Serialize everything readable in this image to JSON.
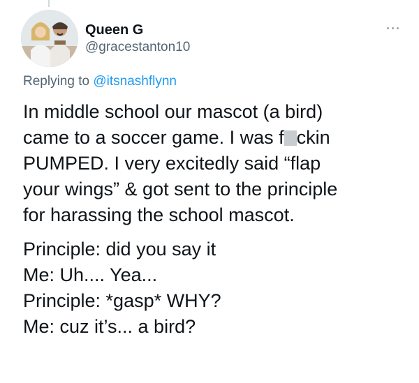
{
  "tweet": {
    "display_name": "Queen G",
    "handle": "@gracestanton10",
    "replying_prefix": "Replying to",
    "replying_to": "@itsnashflynn",
    "paragraph1": {
      "l1": "In middle school our mascot (a bird)",
      "l2_before": "came to a soccer game. I was f",
      "l2_after": "ckin",
      "l3": "PUMPED. I very excitedly said “flap",
      "l4": "your wings” & got sent to the principle",
      "l5": "for harassing the school mascot."
    },
    "dialogue": [
      "Principle: did you say it",
      "Me:  Uh.... Yea...",
      "Principle:  *gasp* WHY?",
      "Me: cuz it’s... a bird?"
    ]
  },
  "icons": {
    "more": "more-horizontal-icon",
    "avatar": "profile-photo"
  },
  "colors": {
    "text": "#0f1419",
    "secondary": "#536471",
    "link": "#1d9bf0"
  }
}
